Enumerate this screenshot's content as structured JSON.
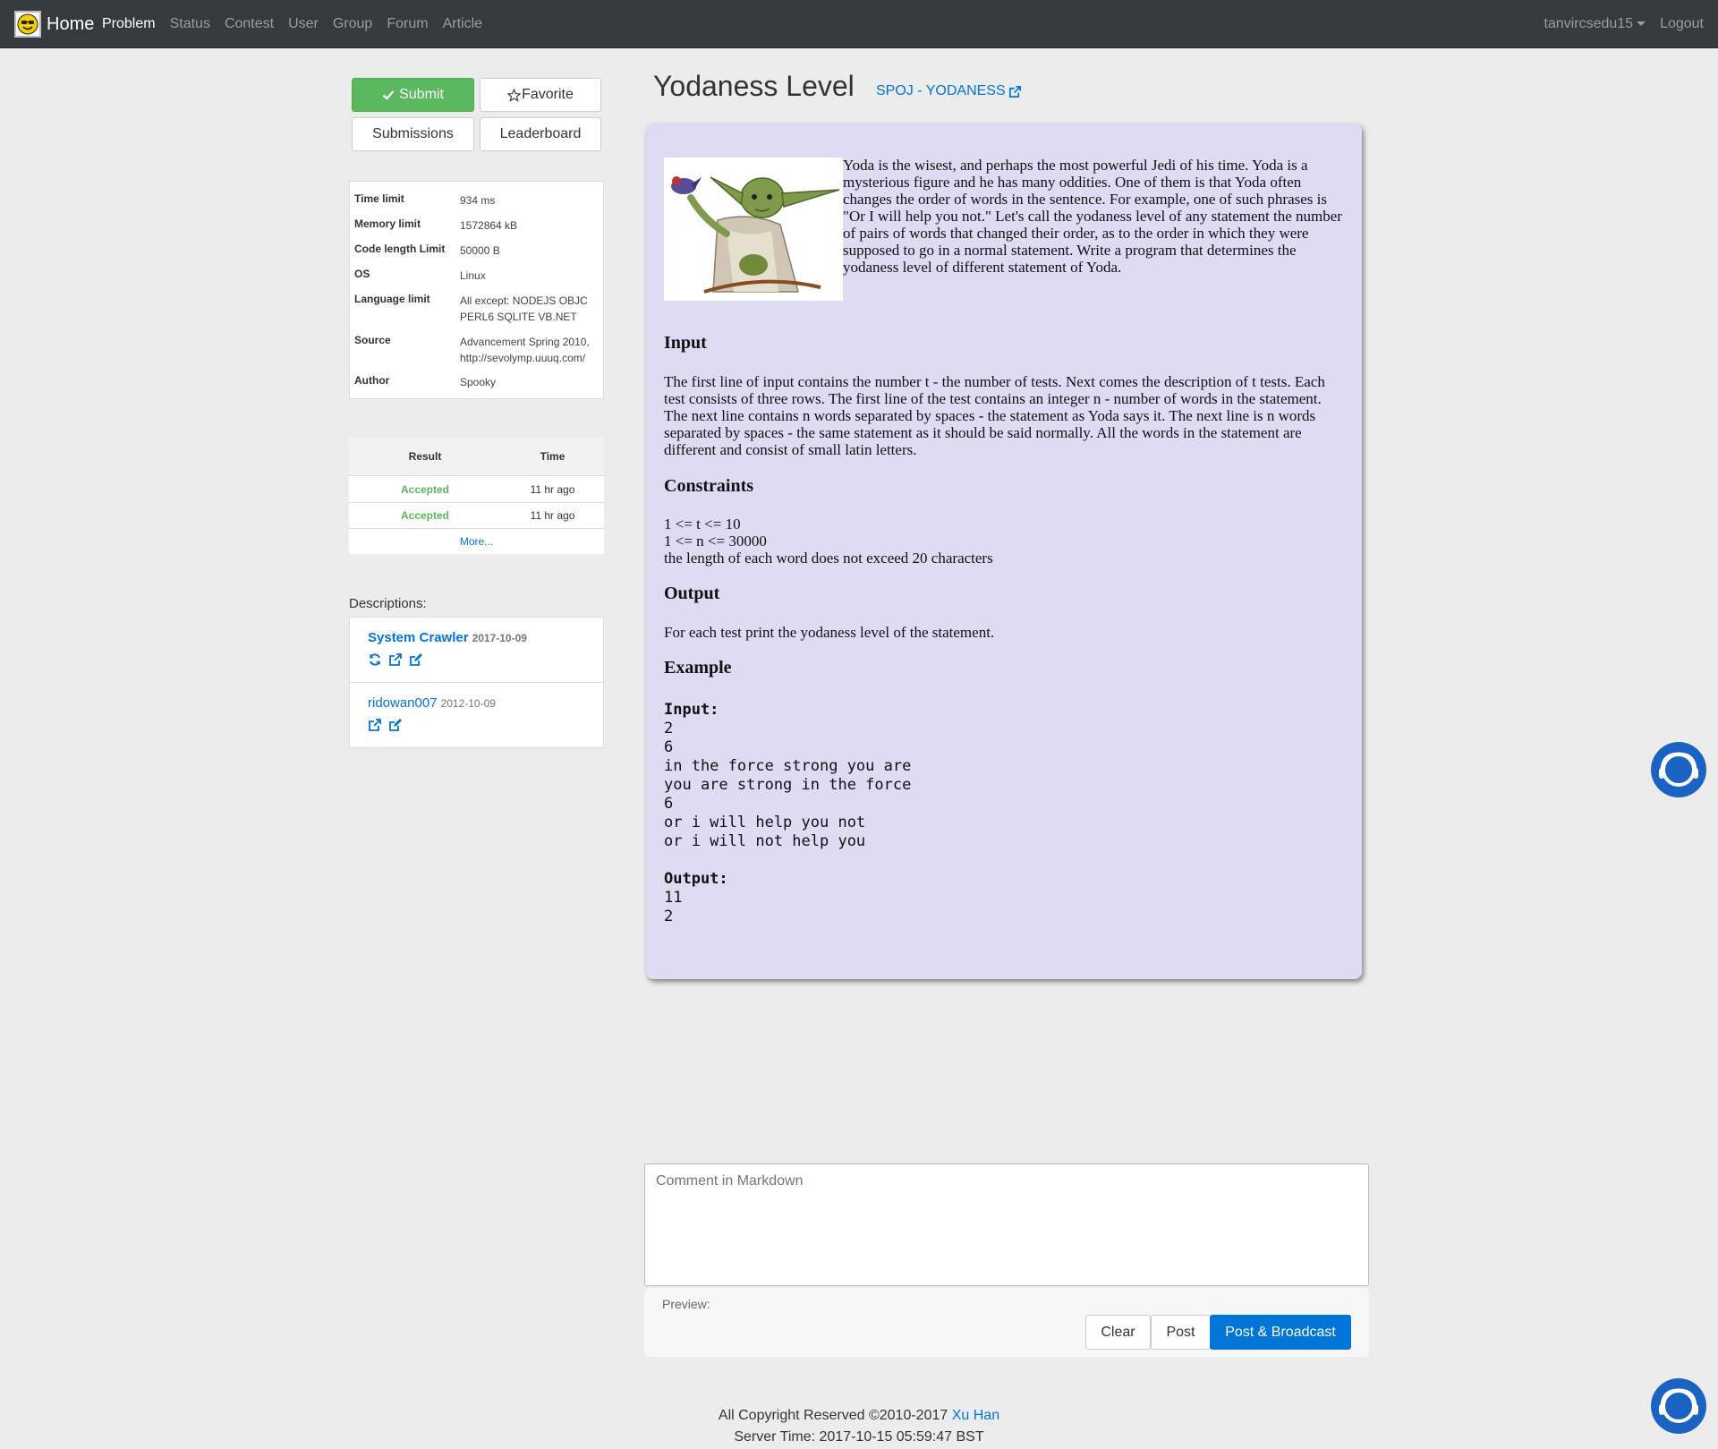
{
  "navbar": {
    "brand": "Home",
    "links": [
      "Problem",
      "Status",
      "Contest",
      "User",
      "Group",
      "Forum",
      "Article"
    ],
    "active": "Problem",
    "username": "tanvircsedu15",
    "logout": "Logout"
  },
  "actions": {
    "submit": "Submit",
    "favorite": "Favorite",
    "submissions": "Submissions",
    "leaderboard": "Leaderboard"
  },
  "info": {
    "time_limit_key": "Time limit",
    "time_limit": "934 ms",
    "memory_limit_key": "Memory limit",
    "memory_limit": "1572864 kB",
    "code_length_key": "Code length Limit",
    "code_length": "50000 B",
    "os_key": "OS",
    "os": "Linux",
    "language_key": "Language limit",
    "language": "All except: NODEJS OBJC PERL6 SQLITE VB.NET",
    "source_key": "Source",
    "source": "Advancement Spring 2010, http://sevolymp.uuuq.com/",
    "author_key": "Author",
    "author": "Spooky"
  },
  "results": {
    "col_result": "Result",
    "col_time": "Time",
    "rows": [
      {
        "result": "Accepted",
        "time": "11 hr ago"
      },
      {
        "result": "Accepted",
        "time": "11 hr ago"
      }
    ],
    "more": "More..."
  },
  "descriptions": {
    "label": "Descriptions:",
    "items": [
      {
        "name": "System Crawler",
        "date": "2017-10-09"
      },
      {
        "name": "ridowan007",
        "date": "2012-10-09"
      }
    ]
  },
  "problem": {
    "title": "Yodaness Level",
    "origin": "SPOJ - YODANESS",
    "intro": "Yoda is the wisest, and perhaps the most powerful Jedi of his time. Yoda is a mysterious figure and he has many oddities. One of them is that Yoda often changes the order of words in the sentence. For example, one of such phrases is \"Or I will help you not.\" Let's call the yodaness level of any statement the number of pairs of words that changed their order, as to the order in which they were supposed to go in a normal statement. Write a program that determines the yodaness level of different statement of Yoda.",
    "input_h": "Input",
    "input_text": "The first line of input contains the number t - the number of tests. Next comes the description of t tests. Each test consists of three rows. The first line of the test contains an integer n - number of words in the statement. The next line contains n words separated by spaces - the statement as Yoda says it. The next line is n words separated by spaces - the same statement as it should be said normally. All the words in the statement are different and consist of small latin letters.",
    "constraints_h": "Constraints",
    "constraint_1": "1 <= t <= 10",
    "constraint_2": "1 <= n <= 30000",
    "constraint_3": "the length of each word does not exceed 20 characters",
    "output_h": "Output",
    "output_text": "For each test print the yodaness level of the statement.",
    "example_h": "Example",
    "example_input_label": "Input:",
    "example_input": "2\n6\nin the force strong you are\nyou are strong in the force\n6\nor i will help you not\nor i will not help you",
    "example_output_label": "Output:",
    "example_output": "11\n2"
  },
  "comment": {
    "placeholder": "Comment in Markdown",
    "preview": "Preview:",
    "clear": "Clear",
    "post": "Post",
    "broadcast": "Post & Broadcast"
  },
  "footer": {
    "copyright": "All Copyright Reserved ©2010-2017",
    "author_link": "Xu Han",
    "server_time": "Server Time: 2017-10-15 05:59:47 BST"
  },
  "colors": {
    "accent": "#0275d8",
    "success": "#5cb85c",
    "navbar": "#343a40",
    "panel": "#dcdcf2"
  }
}
